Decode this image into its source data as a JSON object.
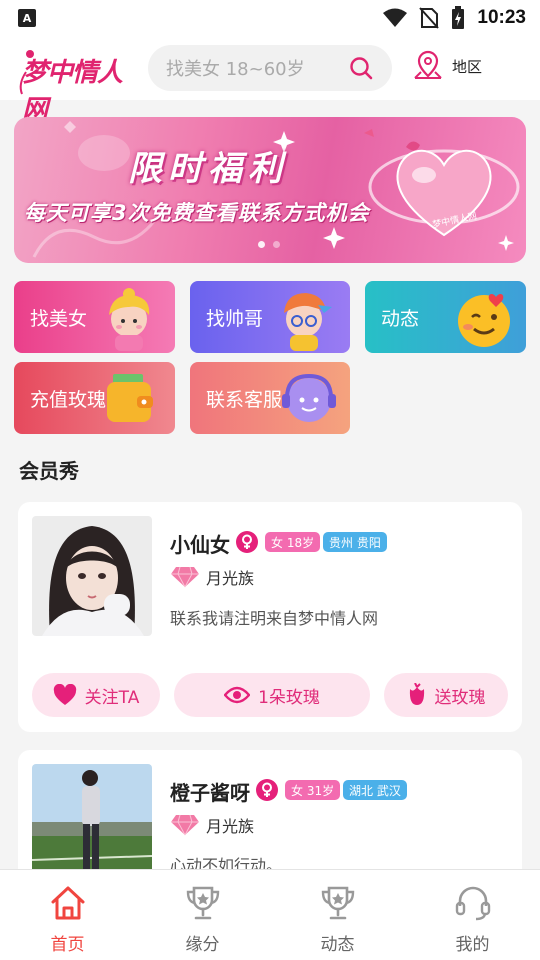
{
  "status_bar": {
    "carrier_icon": "A",
    "time": "10:23"
  },
  "header": {
    "logo_text": "梦中情人网",
    "search_placeholder": "找美女 18~60岁",
    "region_label": "地区"
  },
  "banner": {
    "title": "限时福利",
    "subtitle": "每天可享3次免费查看联系方式机会",
    "seal_text": "梦中情人网",
    "dot_count": 2,
    "active_dot": 0
  },
  "categories": [
    {
      "label": "找美女",
      "color": "#ef4f93"
    },
    {
      "label": "找帅哥",
      "color": "#7b6cf3"
    },
    {
      "label": "动态",
      "color": "#2fbfcc"
    },
    {
      "label": "充值玫瑰",
      "color": "#ea5f6f"
    },
    {
      "label": "联系客服",
      "color": "#f28f82"
    }
  ],
  "members_section": {
    "title": "会员秀",
    "members": [
      {
        "name": "小仙女",
        "gender": "female",
        "age_tag": "女 18岁",
        "location_tag": "贵州 贵阳",
        "level": "月光族",
        "bio": "联系我请注明来自梦中情人网",
        "actions": {
          "follow": "关注TA",
          "roses": "1朵玫瑰",
          "send_rose": "送玫瑰"
        }
      },
      {
        "name": "橙子酱呀",
        "gender": "female",
        "age_tag": "女 31岁",
        "location_tag": "湖北 武汉",
        "level": "月光族",
        "bio": "心动不如行动。"
      }
    ]
  },
  "tab_bar": {
    "active_index": 0,
    "tabs": [
      {
        "label": "首页",
        "icon": "home-icon"
      },
      {
        "label": "缘分",
        "icon": "trophy-icon"
      },
      {
        "label": "动态",
        "icon": "trophy-icon"
      },
      {
        "label": "我的",
        "icon": "headset-icon"
      }
    ]
  },
  "colors": {
    "brand": "#e0246f",
    "tab_active": "#f0453f",
    "tag_age": "#f36bb0",
    "tag_location": "#4bb0e9"
  }
}
